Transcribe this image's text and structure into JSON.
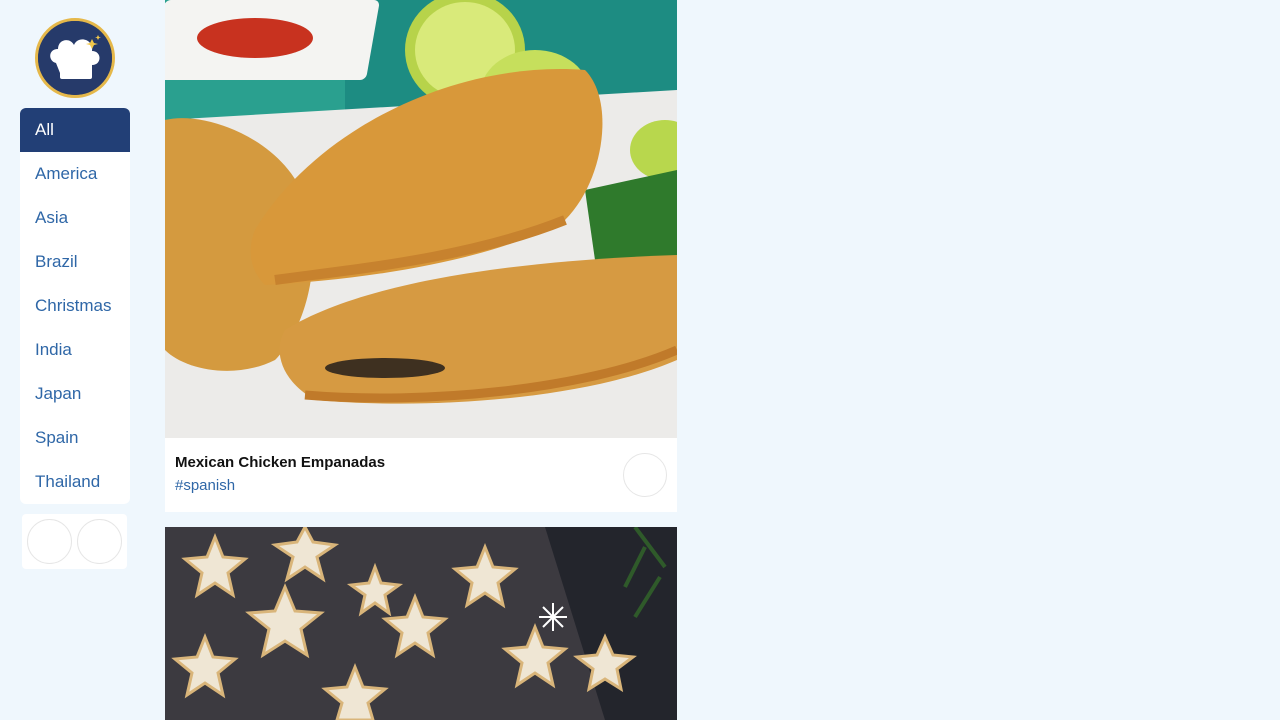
{
  "logo": {
    "icon": "chef-hat-icon",
    "colors": {
      "background": "#263a6a",
      "ring": "#e5b84a"
    }
  },
  "nav": {
    "active_index": 0,
    "items": [
      {
        "label": "All"
      },
      {
        "label": "America"
      },
      {
        "label": "Asia"
      },
      {
        "label": "Brazil"
      },
      {
        "label": "Christmas"
      },
      {
        "label": "India"
      },
      {
        "label": "Japan"
      },
      {
        "label": "Spain"
      },
      {
        "label": "Thailand"
      }
    ]
  },
  "recipes": [
    {
      "title": "Mexican Chicken Empanadas",
      "tag": "#spanish",
      "image": "empanadas-photo"
    },
    {
      "image": "star-cookies-photo"
    }
  ],
  "colors": {
    "accent": "#223f76",
    "link": "#2f67a7",
    "page_bg": "#eff7fd"
  }
}
